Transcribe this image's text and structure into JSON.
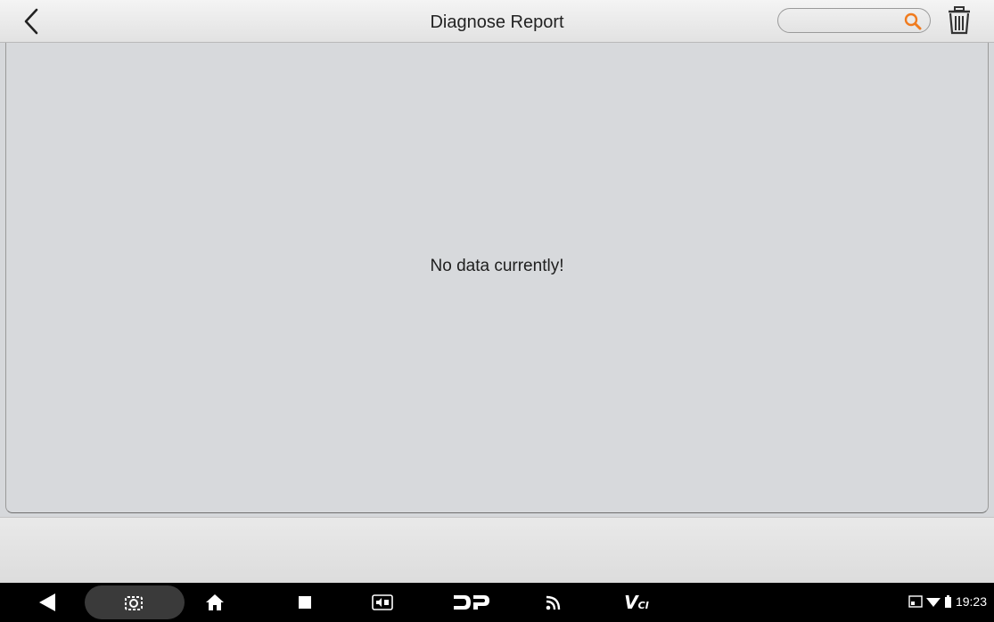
{
  "header": {
    "title": "Diagnose Report",
    "search_placeholder": ""
  },
  "content": {
    "empty_message": "No data currently!"
  },
  "navbar": {
    "vci_label": "V",
    "vci_sub": "CI",
    "dp_label": "DP"
  },
  "status_bar": {
    "time": "19:23"
  },
  "colors": {
    "accent": "#f07b1e",
    "background": "#d7d9dc",
    "navbar": "#000000"
  }
}
